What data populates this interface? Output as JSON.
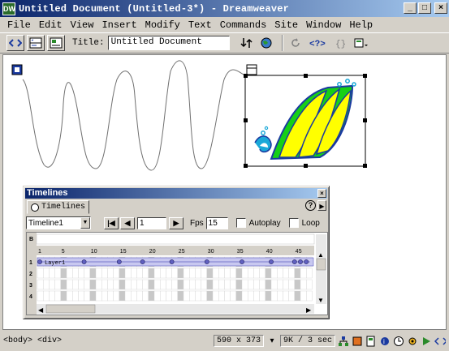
{
  "window": {
    "title": "Untitled Document (Untitled-3*) - Dreamweaver",
    "app_icon_glyph": "DW",
    "buttons": [
      "_",
      "□",
      "×"
    ]
  },
  "menubar": [
    "File",
    "Edit",
    "View",
    "Insert",
    "Modify",
    "Text",
    "Commands",
    "Site",
    "Window",
    "Help"
  ],
  "toolbar": {
    "title_label": "Title:",
    "title_value": "Untitled Document"
  },
  "timelines_panel": {
    "title": "Timelines",
    "tab_label": "Timelines",
    "timeline_select": "Timeline1",
    "frame_value": "1",
    "fps_label": "Fps",
    "fps_value": "15",
    "autoplay_label": "Autoplay",
    "loop_label": "Loop",
    "behavior_row_label": "B",
    "frame_numbers": [
      "1",
      "5",
      "10",
      "15",
      "20",
      "25",
      "30",
      "35",
      "40",
      "45"
    ],
    "channels": [
      "1",
      "2",
      "3",
      "4"
    ],
    "layer_name": "Layer1"
  },
  "statusbar": {
    "tags": "<body> <div>",
    "window_size": "590 x 373",
    "download": "9K / 3 sec"
  },
  "colors": {
    "titlebar_start": "#0a246a",
    "titlebar_end": "#a6caf0",
    "wave_green": "#16d016",
    "wave_yellow": "#ffff00",
    "wave_outline": "#1a3aa0",
    "timeline_bar": "#c8c8f0",
    "keyframe": "#6060c0"
  }
}
